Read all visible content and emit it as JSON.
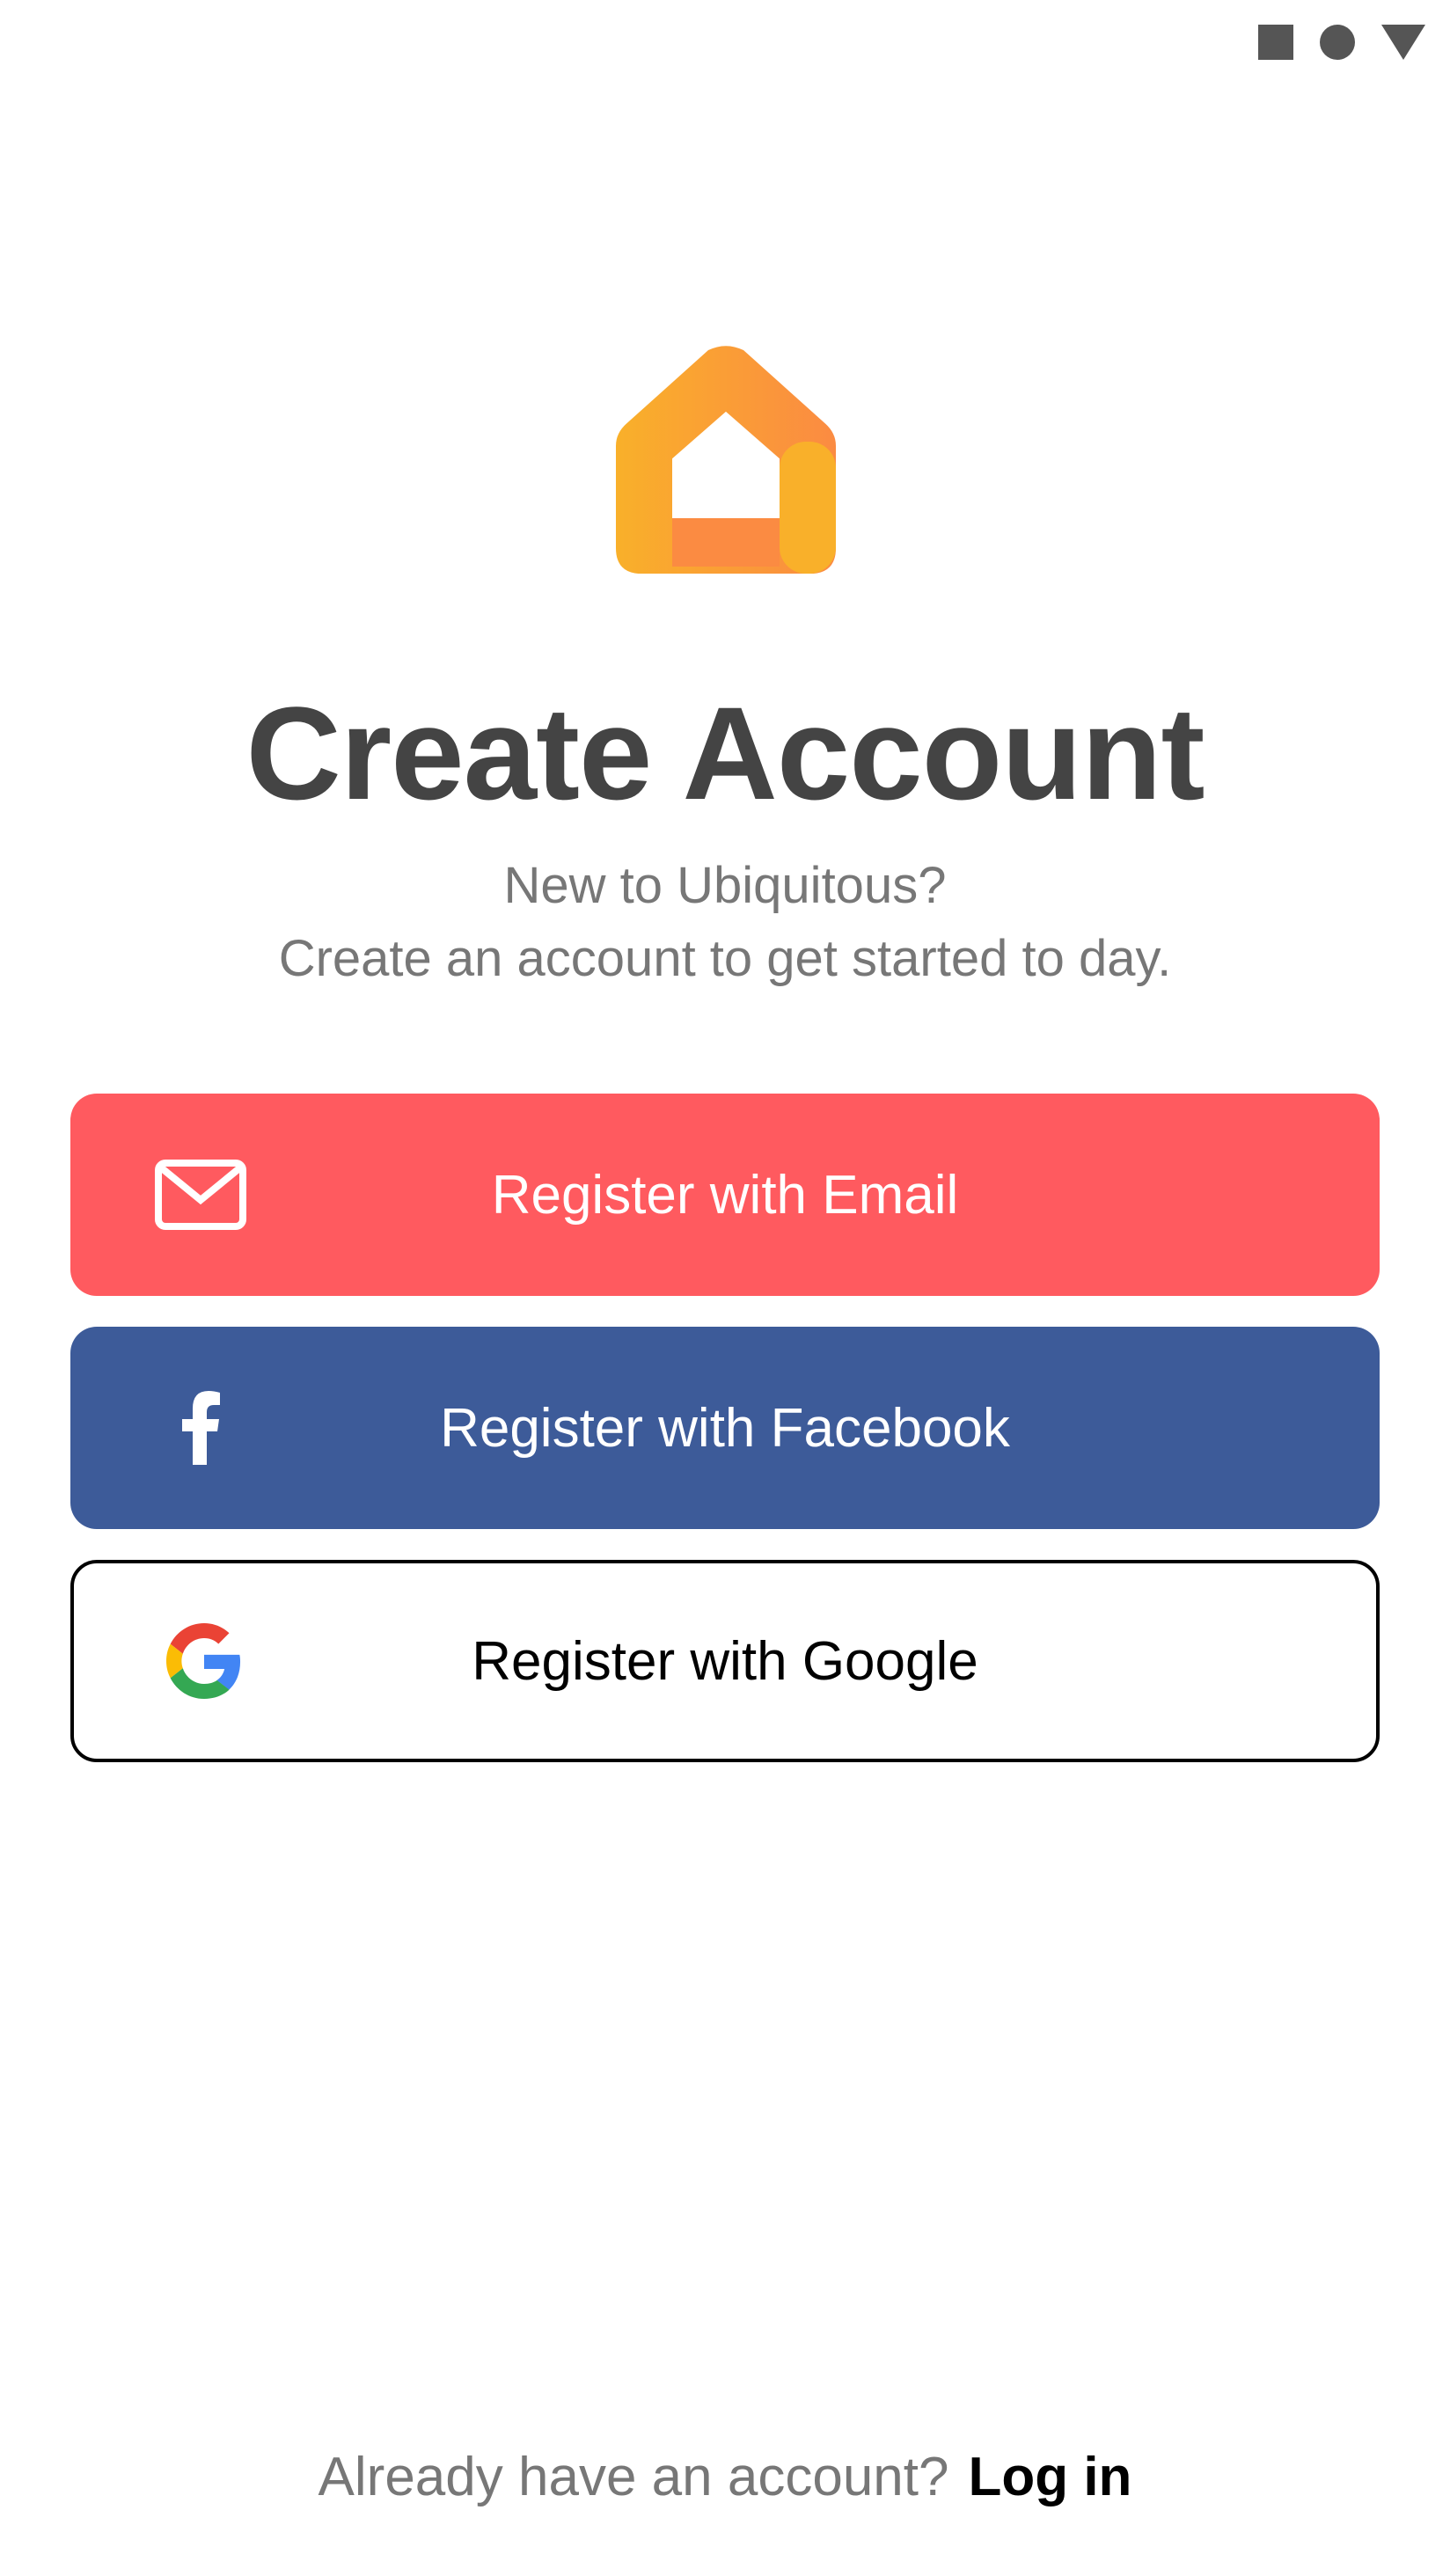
{
  "status_bar": {
    "icons": [
      "square-icon",
      "circle-icon",
      "triangle-icon"
    ]
  },
  "logo": {
    "icon": "house-logo",
    "colors": [
      "#f9b02a",
      "#fb8b42"
    ]
  },
  "title": "Create Account",
  "subtitle": {
    "line1": "New to Ubiquitous?",
    "line2": "Create an account to get started to day."
  },
  "buttons": {
    "email": {
      "label": "Register with Email",
      "icon": "mail-icon",
      "color": "#ff5a5f"
    },
    "facebook": {
      "label": "Register with Facebook",
      "icon": "facebook-icon",
      "color": "#3d5b99"
    },
    "google": {
      "label": "Register with Google",
      "icon": "google-icon",
      "color": "#ffffff"
    }
  },
  "footer": {
    "prompt": "Already have an account?",
    "link": "Log in"
  }
}
